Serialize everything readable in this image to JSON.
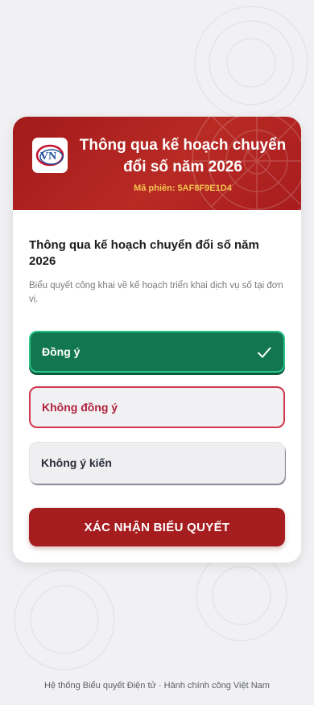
{
  "header": {
    "logo_text": "VN",
    "title": "Thông qua kế hoạch chuyển đổi số năm 2026",
    "session_code": "Mã phiên: 5AF8F9E1D4"
  },
  "motion": {
    "title": "Thông qua kế hoạch chuyển đổi số năm 2026",
    "description": "Biểu quyết công khai về kế hoạch triển khai dịch vụ số tại đơn vị."
  },
  "options": [
    {
      "label": "Đồng ý",
      "selected": true
    },
    {
      "label": "Không đồng ý",
      "selected": false
    },
    {
      "label": "Không ý kiến",
      "selected": false
    }
  ],
  "confirm_label": "XÁC NHẬN BIỂU QUYẾT",
  "footer": "Hệ thống Biểu quyết Điện tử · Hành chính công Việt Nam",
  "colors": {
    "brand_red": "#a61d20",
    "agree_green": "#127751",
    "disagree_red": "#d2374f",
    "session_gold": "#f5c451"
  },
  "icons": {
    "logo": "vn-logo-icon",
    "selected": "check-icon"
  }
}
